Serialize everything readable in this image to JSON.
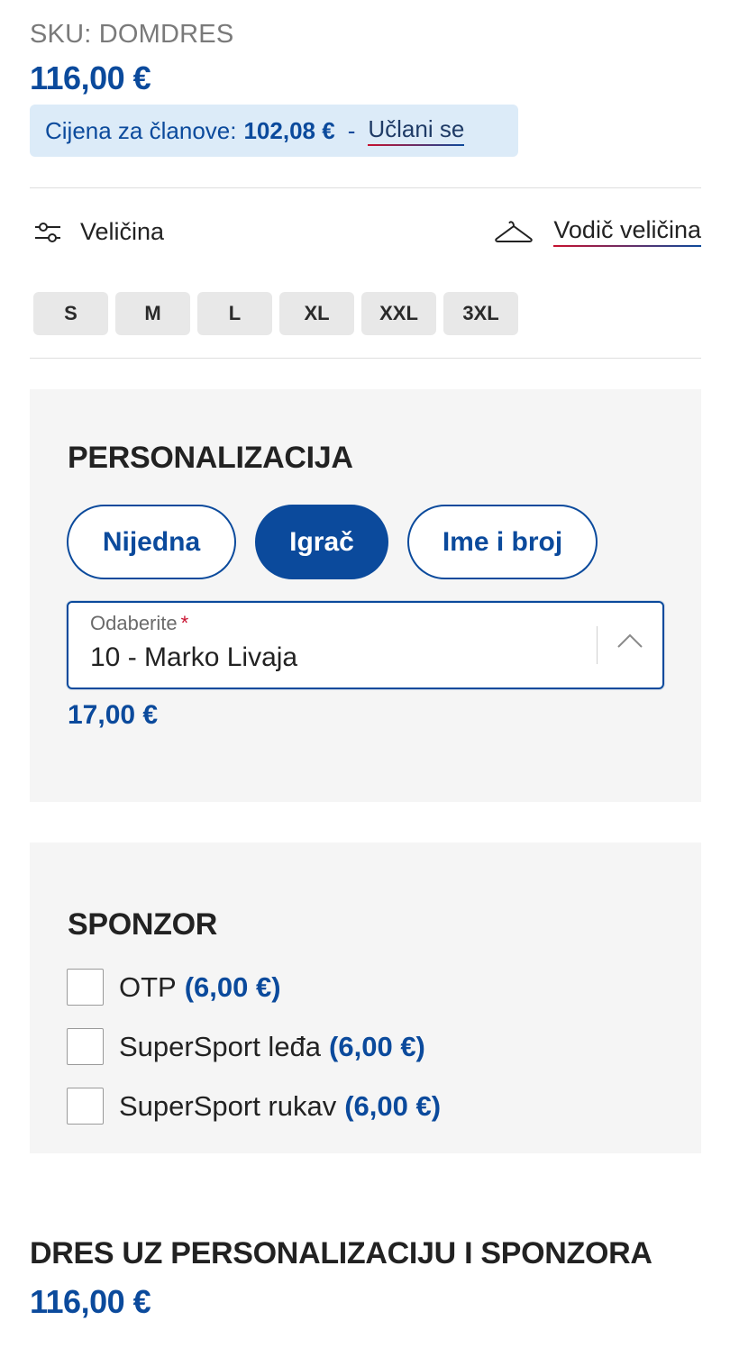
{
  "product": {
    "sku": "SKU: DOMDRES",
    "price": "116,00 €"
  },
  "membership": {
    "label": "Cijena za članove:",
    "price": "102,08 €",
    "separator": "-",
    "join_link": "Učlani se"
  },
  "size": {
    "label": "Veličina",
    "guide_link": "Vodič veličina",
    "options": [
      "S",
      "M",
      "L",
      "XL",
      "XXL",
      "3XL"
    ]
  },
  "personalization": {
    "title": "PERSONALIZACIJA",
    "options": [
      {
        "label": "Nijedna",
        "active": false
      },
      {
        "label": "Igrač",
        "active": true
      },
      {
        "label": "Ime i broj",
        "active": false
      }
    ],
    "select": {
      "label": "Odaberite",
      "required_mark": "*",
      "value": "10 - Marko Livaja"
    },
    "price": "17,00 €"
  },
  "sponsor": {
    "title": "SPONZOR",
    "items": [
      {
        "label": "OTP",
        "price": "(6,00 €)",
        "checked": false
      },
      {
        "label": "SuperSport leđa",
        "price": "(6,00 €)",
        "checked": false
      },
      {
        "label": "SuperSport rukav",
        "price": "(6,00 €)",
        "checked": false
      }
    ]
  },
  "summary": {
    "title": "DRES UZ PERSONALIZACIJU I SPONZORA",
    "price": "116,00 €"
  },
  "colors": {
    "brand_blue": "#0b4a9c",
    "member_bg": "#dcebf8",
    "accent_red": "#c8102e"
  },
  "icons": {
    "size_filter": "sliders-icon",
    "size_guide": "hanger-icon",
    "select_toggle": "chevron-up-icon"
  }
}
